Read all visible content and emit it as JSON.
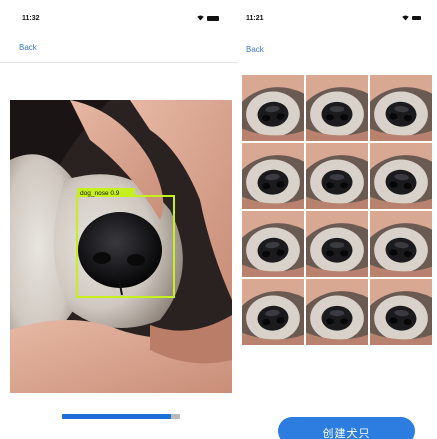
{
  "left_screen": {
    "status_time": "11:32",
    "back_label": "Back",
    "detection": {
      "label": "dog_nose 0.9",
      "box_color": "#c6ef1e"
    },
    "progress": {
      "fraction": 0.92,
      "fill_color": "#1f6fd8",
      "track_color": "#b9b9b9"
    }
  },
  "right_screen": {
    "status_time": "11:21",
    "back_label": "Back",
    "thumbnail_count": 12,
    "create_button_label": "创建犬只",
    "button_color": "#2d7de0"
  },
  "icons": [
    "wifi-icon",
    "battery-icon"
  ]
}
